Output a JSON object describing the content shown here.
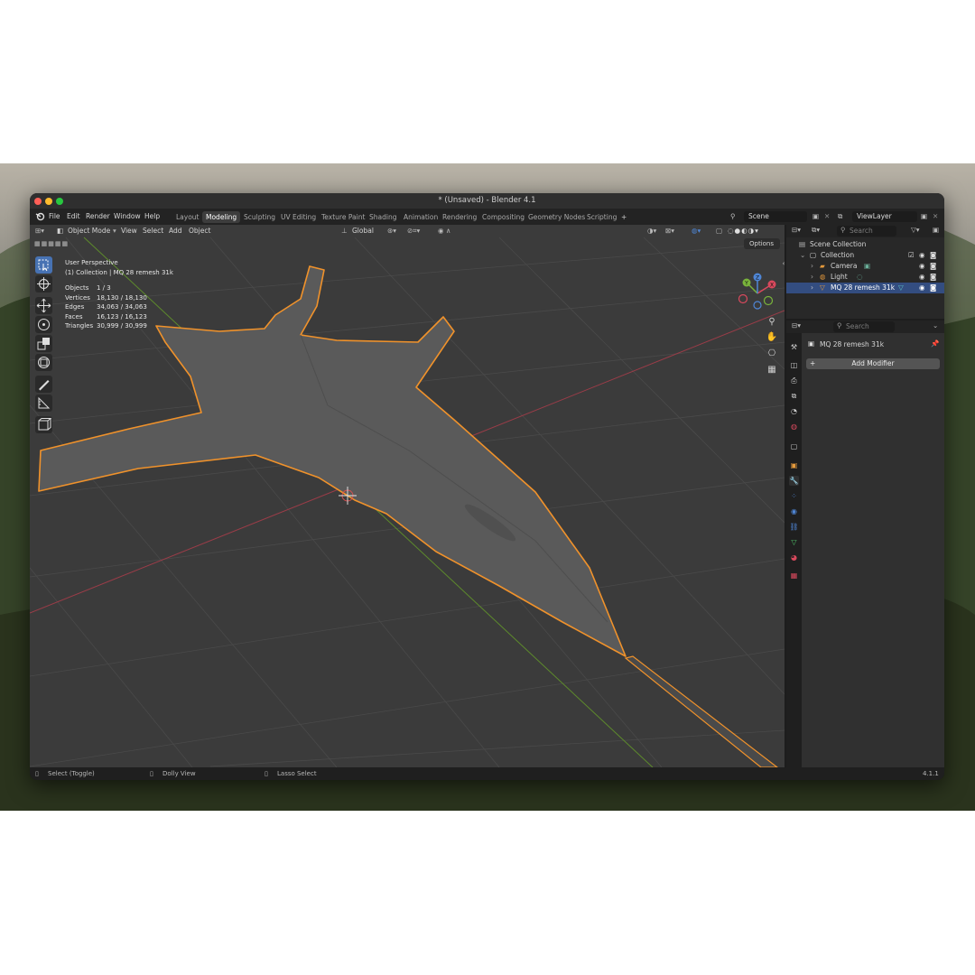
{
  "window": {
    "title": "* (Unsaved) - Blender 4.1"
  },
  "menu": [
    "File",
    "Edit",
    "Render",
    "Window",
    "Help"
  ],
  "workspaces": [
    {
      "label": "Layout"
    },
    {
      "label": "Modeling",
      "active": true
    },
    {
      "label": "Sculpting"
    },
    {
      "label": "UV Editing"
    },
    {
      "label": "Texture Paint"
    },
    {
      "label": "Shading"
    },
    {
      "label": "Animation"
    },
    {
      "label": "Rendering"
    },
    {
      "label": "Compositing"
    },
    {
      "label": "Geometry Nodes"
    },
    {
      "label": "Scripting"
    }
  ],
  "add_workspace": "+",
  "scene": {
    "value": "Scene"
  },
  "view_layer": {
    "value": "ViewLayer"
  },
  "viewport": {
    "mode": "Object Mode",
    "menus": [
      "View",
      "Select",
      "Add",
      "Object"
    ],
    "orientation": "Global",
    "options_label": "Options",
    "perspective": "User Perspective",
    "collection_info": "(1) Collection | MQ 28 remesh 31k",
    "stats": [
      {
        "label": "Objects",
        "value": "1 / 3"
      },
      {
        "label": "Vertices",
        "value": "18,130 / 18,130"
      },
      {
        "label": "Edges",
        "value": "34,063 / 34,063"
      },
      {
        "label": "Faces",
        "value": "16,123 / 16,123"
      },
      {
        "label": "Triangles",
        "value": "30,999 / 30,999"
      }
    ],
    "gizmo": {
      "x": "X",
      "y": "Y",
      "z": "Z"
    }
  },
  "outliner": {
    "search_placeholder": "Search",
    "scene_collection": "Scene Collection",
    "collection": "Collection",
    "items": [
      "Camera",
      "Light",
      "MQ 28 remesh 31k"
    ]
  },
  "properties": {
    "search_placeholder": "Search",
    "object_name": "MQ 28 remesh 31k",
    "add_modifier": "Add Modifier"
  },
  "status": {
    "select": "Select (Toggle)",
    "dolly": "Dolly View",
    "lasso": "Lasso Select",
    "version": "4.1.1"
  },
  "colors": {
    "accent": "#4772b3",
    "selection_outline": "#f0922b",
    "viewport_bg": "#3b3b3b"
  }
}
